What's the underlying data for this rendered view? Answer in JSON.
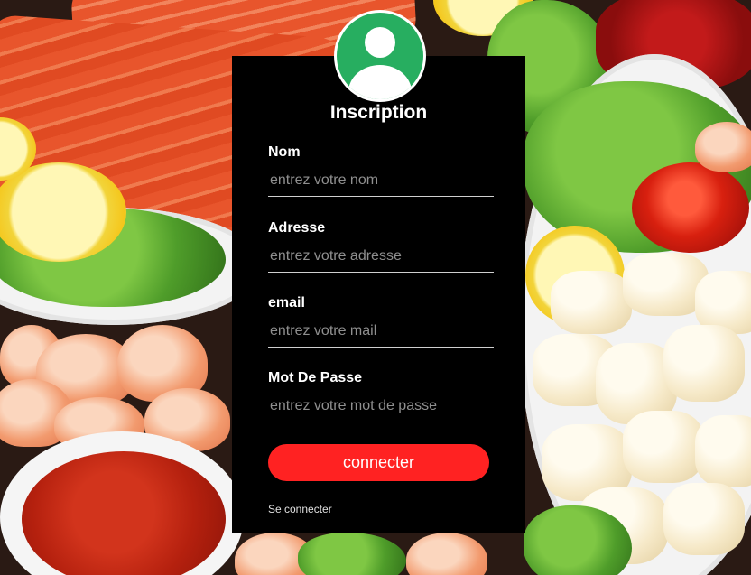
{
  "form": {
    "title": "Inscription",
    "fields": [
      {
        "label": "Nom",
        "placeholder": "entrez votre nom",
        "value": ""
      },
      {
        "label": "Adresse",
        "placeholder": "entrez votre adresse",
        "value": ""
      },
      {
        "label": "email",
        "placeholder": "entrez votre mail",
        "value": ""
      },
      {
        "label": "Mot De Passe",
        "placeholder": "entrez votre mot de passe",
        "value": ""
      }
    ],
    "submit_label": "connecter",
    "login_link": "Se connecter"
  },
  "icons": {
    "avatar": "user-avatar-icon"
  },
  "colors": {
    "card_background": "#000000",
    "avatar_green": "#27ae60",
    "button_red": "#ff2222",
    "text": "#ffffff",
    "placeholder": "#8f8f8f"
  }
}
